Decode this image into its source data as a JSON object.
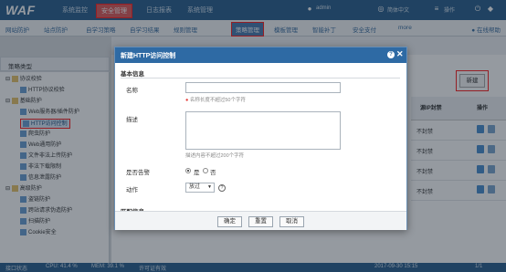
{
  "app": {
    "logo": "WAF"
  },
  "topnav": {
    "items": [
      {
        "label": "系统监控",
        "active": false
      },
      {
        "label": "安全管理",
        "active": true
      },
      {
        "label": "日志报表",
        "active": false
      },
      {
        "label": "系统管理",
        "active": false
      }
    ],
    "right": {
      "user": "admin",
      "language": "简体中文",
      "menu": "操作"
    }
  },
  "subnav": {
    "items": [
      {
        "label": "网站防护",
        "active": false
      },
      {
        "label": "站点防护",
        "active": false
      },
      {
        "label": "自学习策略",
        "active": false
      },
      {
        "label": "自学习结果",
        "active": false
      },
      {
        "label": "规则管理",
        "active": false
      },
      {
        "label": "策略管理",
        "active": true
      },
      {
        "label": "模板管理",
        "active": false
      },
      {
        "label": "智能补丁",
        "active": false
      },
      {
        "label": "安全支付",
        "active": false
      },
      {
        "label": "more",
        "active": false
      }
    ],
    "help": "在线帮助"
  },
  "sidebar": {
    "title": "策略类型",
    "items": [
      {
        "label": "协议校验",
        "level": 0
      },
      {
        "label": "HTTP协议校验",
        "level": 1
      },
      {
        "label": "基础防护",
        "level": 0
      },
      {
        "label": "Web服务器/插件防护",
        "level": 1
      },
      {
        "label": "HTTP访问控制",
        "level": 1,
        "selected": true
      },
      {
        "label": "爬虫防护",
        "level": 1
      },
      {
        "label": "Web通用防护",
        "level": 1
      },
      {
        "label": "文件非法上传防护",
        "level": 1
      },
      {
        "label": "非法下载限制",
        "level": 1
      },
      {
        "label": "信息泄露防护",
        "level": 1
      },
      {
        "label": "高级防护",
        "level": 0
      },
      {
        "label": "盗链防护",
        "level": 1
      },
      {
        "label": "跨站请求伪造防护",
        "level": 1
      },
      {
        "label": "扫描防护",
        "level": 1
      },
      {
        "label": "Cookie安全",
        "level": 1
      }
    ]
  },
  "main": {
    "new_button": "新建",
    "columns": [
      "源IP封禁",
      "操作"
    ],
    "rows": [
      {
        "ip_block": "不封禁"
      },
      {
        "ip_block": "不封禁"
      },
      {
        "ip_block": "不封禁"
      },
      {
        "ip_block": "不封禁"
      }
    ]
  },
  "statusbar": {
    "login_status": "接口状态",
    "cpu": "CPU: 41.4 %",
    "mem": "MEM: 39.1 %",
    "license": "许可证有效",
    "datetime": "2017-09-30 15:15",
    "pagination": "1/1"
  },
  "modal": {
    "title": "新建HTTP访问控制",
    "section_basic": "基本信息",
    "name_label": "名称",
    "name_value": "",
    "name_hint": "名称长度不超过50个字符",
    "desc_label": "描述",
    "desc_value": "",
    "desc_hint": "描述内容不超过200个字符",
    "enabled_label": "是否告警",
    "enabled_yes": "是",
    "enabled_no": "否",
    "action_label": "动作",
    "action_value": "放过",
    "section_match": "匹配信息",
    "buttons": {
      "confirm": "确定",
      "reset": "重置",
      "cancel": "取消"
    }
  }
}
